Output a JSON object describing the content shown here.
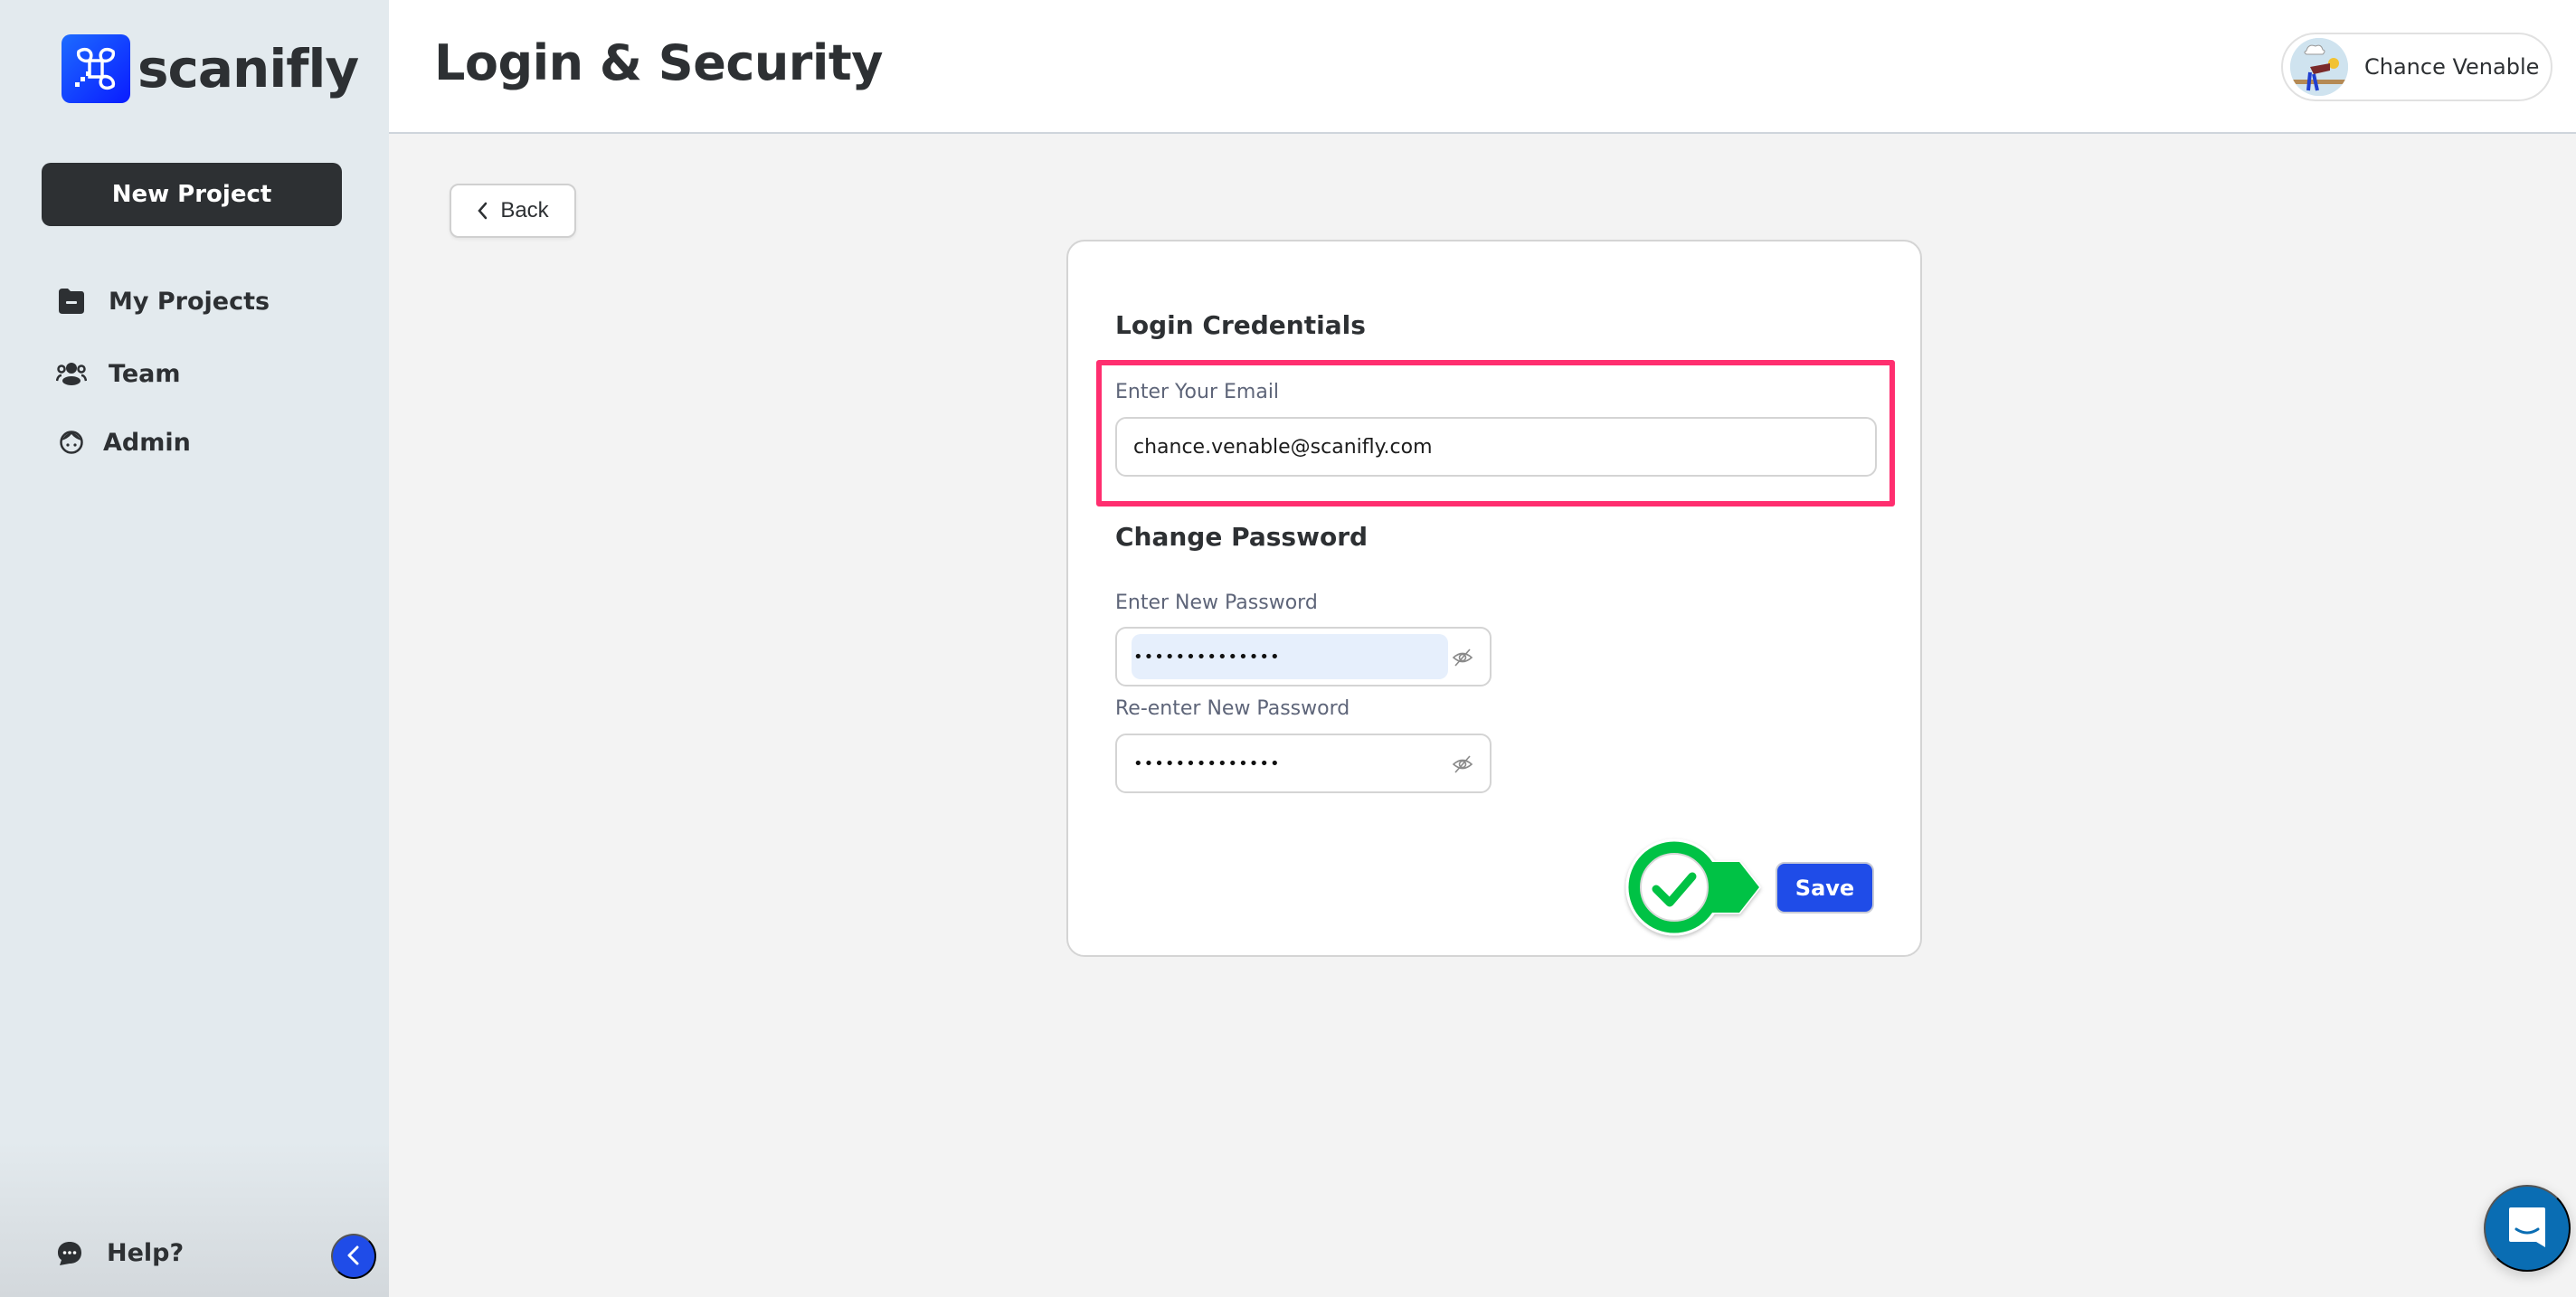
{
  "app": {
    "brand": "scanifly",
    "logo_icon": "scanifly-logo-icon"
  },
  "sidebar": {
    "new_project_label": "New Project",
    "items": [
      {
        "label": "My Projects",
        "icon": "folder-icon"
      },
      {
        "label": "Team",
        "icon": "team-icon"
      },
      {
        "label": "Admin",
        "icon": "admin-face-icon"
      }
    ],
    "help_label": "Help?",
    "help_icon": "chat-bubble-icon",
    "collapse_icon": "chevron-left-icon"
  },
  "header": {
    "title": "Login & Security",
    "user_name": "Chance Venable",
    "avatar_icon": "user-avatar"
  },
  "back_button": {
    "label": "Back",
    "icon": "chevron-left-icon"
  },
  "form": {
    "credentials_title": "Login Credentials",
    "email_label": "Enter Your Email",
    "email_value": "chance.venable@scanifly.com",
    "change_password_title": "Change Password",
    "new_password_label": "Enter New Password",
    "new_password_value": "••••••••••••••",
    "reenter_password_label": "Re-enter New Password",
    "reenter_password_value": "••••••••••••••",
    "visibility_icon": "eye-off-icon",
    "save_label": "Save"
  },
  "annotations": {
    "highlight_color": "#ff2e6f",
    "check_marker_color": "#00c244"
  },
  "colors": {
    "primary": "#1f4ce8",
    "sidebar_bg": "#e3eaee",
    "dark_button": "#2d3033",
    "chat_launcher": "#0a6db3"
  }
}
